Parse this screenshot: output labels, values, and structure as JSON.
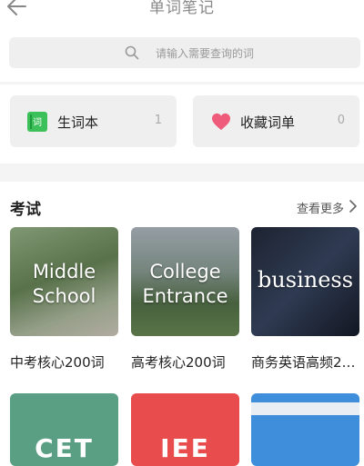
{
  "header": {
    "title": "单词笔记",
    "back_icon": "arrow-left-icon"
  },
  "search": {
    "placeholder": "请输入需要查询的词",
    "icon": "search-icon"
  },
  "cards": [
    {
      "label": "生词本",
      "count": "1",
      "icon": "vocab-book-icon",
      "icon_text": "词",
      "icon_color": "#3cc15a"
    },
    {
      "label": "收藏词单",
      "count": "0",
      "icon": "heart-icon",
      "icon_color": "#ef5b7a"
    }
  ],
  "exam_section": {
    "title": "考试",
    "see_more": "查看更多",
    "see_more_icon": "chevron-right-icon",
    "tiles": [
      {
        "image_lines": [
          "Middle",
          "School"
        ],
        "caption": "中考核心200词"
      },
      {
        "image_lines": [
          "College",
          "Entrance"
        ],
        "caption": "高考核心200词"
      },
      {
        "image_lines": [
          "business"
        ],
        "caption": "商务英语高频2…"
      }
    ],
    "bottom_tiles": [
      {
        "text": "CET",
        "color": "#5a9e83"
      },
      {
        "text": "IEE",
        "color": "#e84c4c"
      },
      {
        "text": "",
        "color": "#3f8edb"
      }
    ]
  }
}
